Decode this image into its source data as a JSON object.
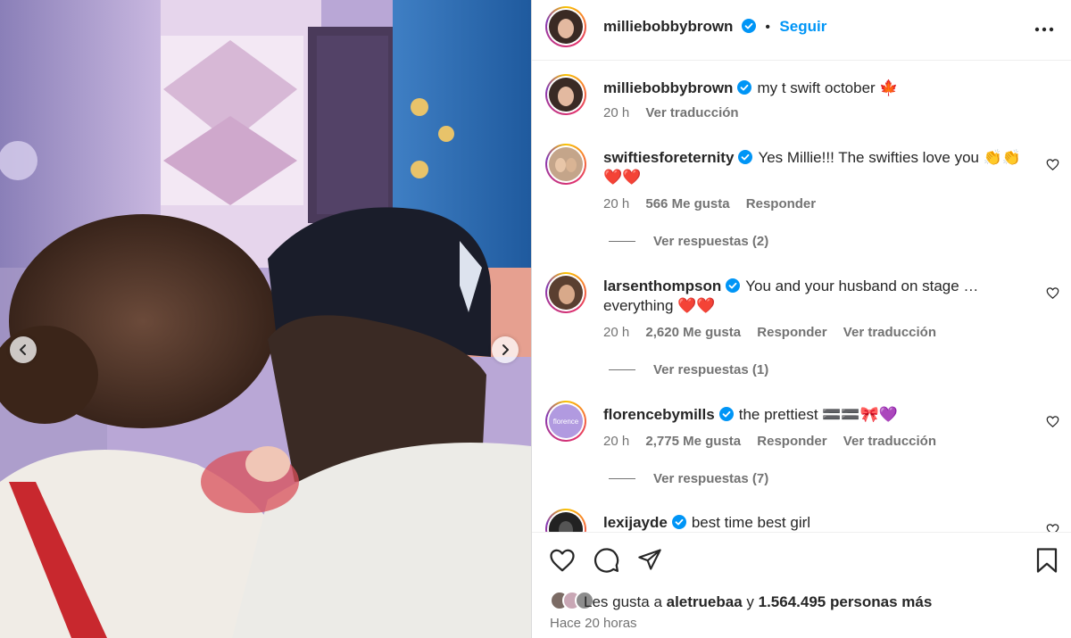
{
  "post_author": {
    "username": "milliebobbybrown",
    "verified": true,
    "follow_label": "Seguir",
    "separator": "•"
  },
  "caption": {
    "username": "milliebobbybrown",
    "text": "my t swift october 🍁",
    "time": "20 h",
    "translate_label": "Ver traducción"
  },
  "comments": [
    {
      "username": "swiftiesforeternity",
      "text": "Yes Millie!!! The swifties love you 👏👏❤️❤️",
      "time": "20 h",
      "likes": "566 Me gusta",
      "reply_label": "Responder",
      "translate_label": "",
      "view_replies": "Ver respuestas (2)"
    },
    {
      "username": "larsenthompson",
      "text": "You and your husband on stage … everything ❤️❤️",
      "time": "20 h",
      "likes": "2,620 Me gusta",
      "reply_label": "Responder",
      "translate_label": "Ver traducción",
      "view_replies": "Ver respuestas (1)"
    },
    {
      "username": "florencebymills",
      "text": "the prettiest 🟰🟰🎀💜",
      "time": "20 h",
      "likes": "2,775 Me gusta",
      "reply_label": "Responder",
      "translate_label": "Ver traducción",
      "view_replies": "Ver respuestas (7)",
      "avatar_text": "florence"
    },
    {
      "username": "lexijayde",
      "text": "best time best girl"
    }
  ],
  "likes": {
    "prefix": "Les gusta a ",
    "user": "aletruebaa",
    "middle": " y ",
    "others": "1.564.495 personas más"
  },
  "time_ago": "Hace 20 horas",
  "icons": {
    "like": "heart-icon",
    "comment": "comment-icon",
    "share": "share-icon",
    "save": "bookmark-icon",
    "more": "more-options-icon",
    "verified": "verified-badge-icon"
  },
  "colors": {
    "accent": "#0095f6",
    "verified": "#0095f6",
    "muted": "#737373",
    "text": "#262626"
  }
}
